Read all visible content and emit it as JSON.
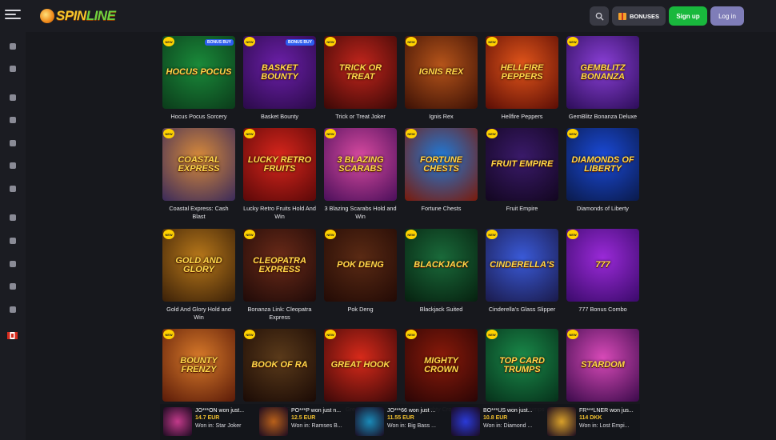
{
  "header": {
    "logo_text": "SPIN",
    "logo_text_accent": "LINE",
    "bonuses_label": "BONUSES",
    "signup_label": "Sign up",
    "login_label": "Log in"
  },
  "sidebar": {
    "icons": [
      "user-icon",
      "user-add-icon",
      "briefcase-icon",
      "casino-chip-icon",
      "basket-icon",
      "shield-icon",
      "crown-icon",
      "calendar-icon",
      "ticket-icon",
      "dice-icon",
      "trophy-icon",
      "target-icon"
    ],
    "flag": "canada-flag-icon"
  },
  "badges": {
    "new": "NEW",
    "bonus_buy": "BONUS BUY"
  },
  "games": [
    {
      "name": "Hocus Pocus Sorcery",
      "art": "Hocus Pocus",
      "bonus": true,
      "bg": "#1a8a3a",
      "bg2": "#0b3b1a"
    },
    {
      "name": "Basket Bounty",
      "art": "Basket Bounty",
      "bonus": true,
      "bg": "#6b1fa8",
      "bg2": "#2a0a48"
    },
    {
      "name": "Trick or Treat Joker",
      "art": "Trick or Treat",
      "bonus": false,
      "bg": "#c2251c",
      "bg2": "#3a0806"
    },
    {
      "name": "Ignis Rex",
      "art": "Ignis Rex",
      "bonus": false,
      "bg": "#b5541a",
      "bg2": "#3b1005"
    },
    {
      "name": "Hellfire Peppers",
      "art": "Hellfire Peppers",
      "bonus": false,
      "bg": "#e2551a",
      "bg2": "#5a0d05"
    },
    {
      "name": "GemBlitz Bonanza Deluxe",
      "art": "GemBlitz Bonanza",
      "bonus": false,
      "bg": "#8a3fd6",
      "bg2": "#2c0d58"
    },
    {
      "name": "Coastal Express: Cash Blast",
      "art": "Coastal Express",
      "bonus": false,
      "bg": "#d88a3a",
      "bg2": "#3a2a5a"
    },
    {
      "name": "Lucky Retro Fruits Hold And Win",
      "art": "Lucky Retro Fruits",
      "bonus": false,
      "bg": "#d8261c",
      "bg2": "#5a0808"
    },
    {
      "name": "3 Blazing Scarabs Hold and Win",
      "art": "3 Blazing Scarabs",
      "bonus": false,
      "bg": "#d84aa0",
      "bg2": "#4a0f5a"
    },
    {
      "name": "Fortune Chests",
      "art": "Fortune Chests",
      "bonus": false,
      "bg": "#1f7ad8",
      "bg2": "#7a1a0a"
    },
    {
      "name": "Fruit Empire",
      "art": "Fruit Empire",
      "bonus": false,
      "bg": "#3a1a6a",
      "bg2": "#12061f"
    },
    {
      "name": "Diamonds of Liberty",
      "art": "Diamonds of Liberty",
      "bonus": false,
      "bg": "#1a4ad8",
      "bg2": "#0a1a4a"
    },
    {
      "name": "Gold And Glory Hold and Win",
      "art": "Gold and Glory",
      "bonus": false,
      "bg": "#b8781a",
      "bg2": "#3a2008"
    },
    {
      "name": "Bonanza Link: Cleopatra Express",
      "art": "Cleopatra Express",
      "bonus": false,
      "bg": "#6a2a18",
      "bg2": "#1f0a08"
    },
    {
      "name": "Pok Deng",
      "art": "Pok Deng",
      "bonus": false,
      "bg": "#5a2a14",
      "bg2": "#220a05"
    },
    {
      "name": "Blackjack Suited",
      "art": "Blackjack",
      "bonus": false,
      "bg": "#1a6a3a",
      "bg2": "#06200f"
    },
    {
      "name": "Cinderella's Glass Slipper",
      "art": "Cinderella's",
      "bonus": false,
      "bg": "#3a5ad8",
      "bg2": "#1a1a4a"
    },
    {
      "name": "777 Bonus Combo",
      "art": "777",
      "bonus": false,
      "bg": "#9a2ad8",
      "bg2": "#3a0a6a"
    },
    {
      "name": "Bounty Frenzy",
      "art": "Bounty Frenzy",
      "bonus": false,
      "bg": "#d87a2a",
      "bg2": "#5a1a08"
    },
    {
      "name": "Book of Ra",
      "art": "Book of Ra",
      "bonus": false,
      "bg": "#5a3a1a",
      "bg2": "#1a0a05"
    },
    {
      "name": "Great Hook",
      "art": "Great Hook",
      "bonus": false,
      "bg": "#d82a1a",
      "bg2": "#3a0808"
    },
    {
      "name": "Mighty Crown",
      "art": "Mighty Crown",
      "bonus": false,
      "bg": "#8a1a0a",
      "bg2": "#2a0505"
    },
    {
      "name": "Top Card Trumps",
      "art": "Top Card Trumps",
      "bonus": false,
      "bg": "#1a8a4a",
      "bg2": "#06301a"
    },
    {
      "name": "Stardom",
      "art": "Stardom",
      "bonus": false,
      "bg": "#d84ab8",
      "bg2": "#3a0a4a"
    }
  ],
  "ticker": [
    {
      "user": "JO***ON won just...",
      "amount": "14.7 EUR",
      "game": "Won in: Star Joker",
      "bg": "#c23a8a"
    },
    {
      "user": "PO***P won just n...",
      "amount": "12.5 EUR",
      "game": "Won in: Ramses B...",
      "bg": "#b8601a"
    },
    {
      "user": "JO***66 won just ...",
      "amount": "11.55 EUR",
      "game": "Won in: Big Bass ...",
      "bg": "#1a8ab8"
    },
    {
      "user": "BO***US won just...",
      "amount": "10.8 EUR",
      "game": "Won in: Diamond ...",
      "bg": "#2a3ad8"
    },
    {
      "user": "FR***LNER won jus...",
      "amount": "114 DKK",
      "game": "Won in: Lost Empi...",
      "bg": "#d8a02a"
    }
  ]
}
